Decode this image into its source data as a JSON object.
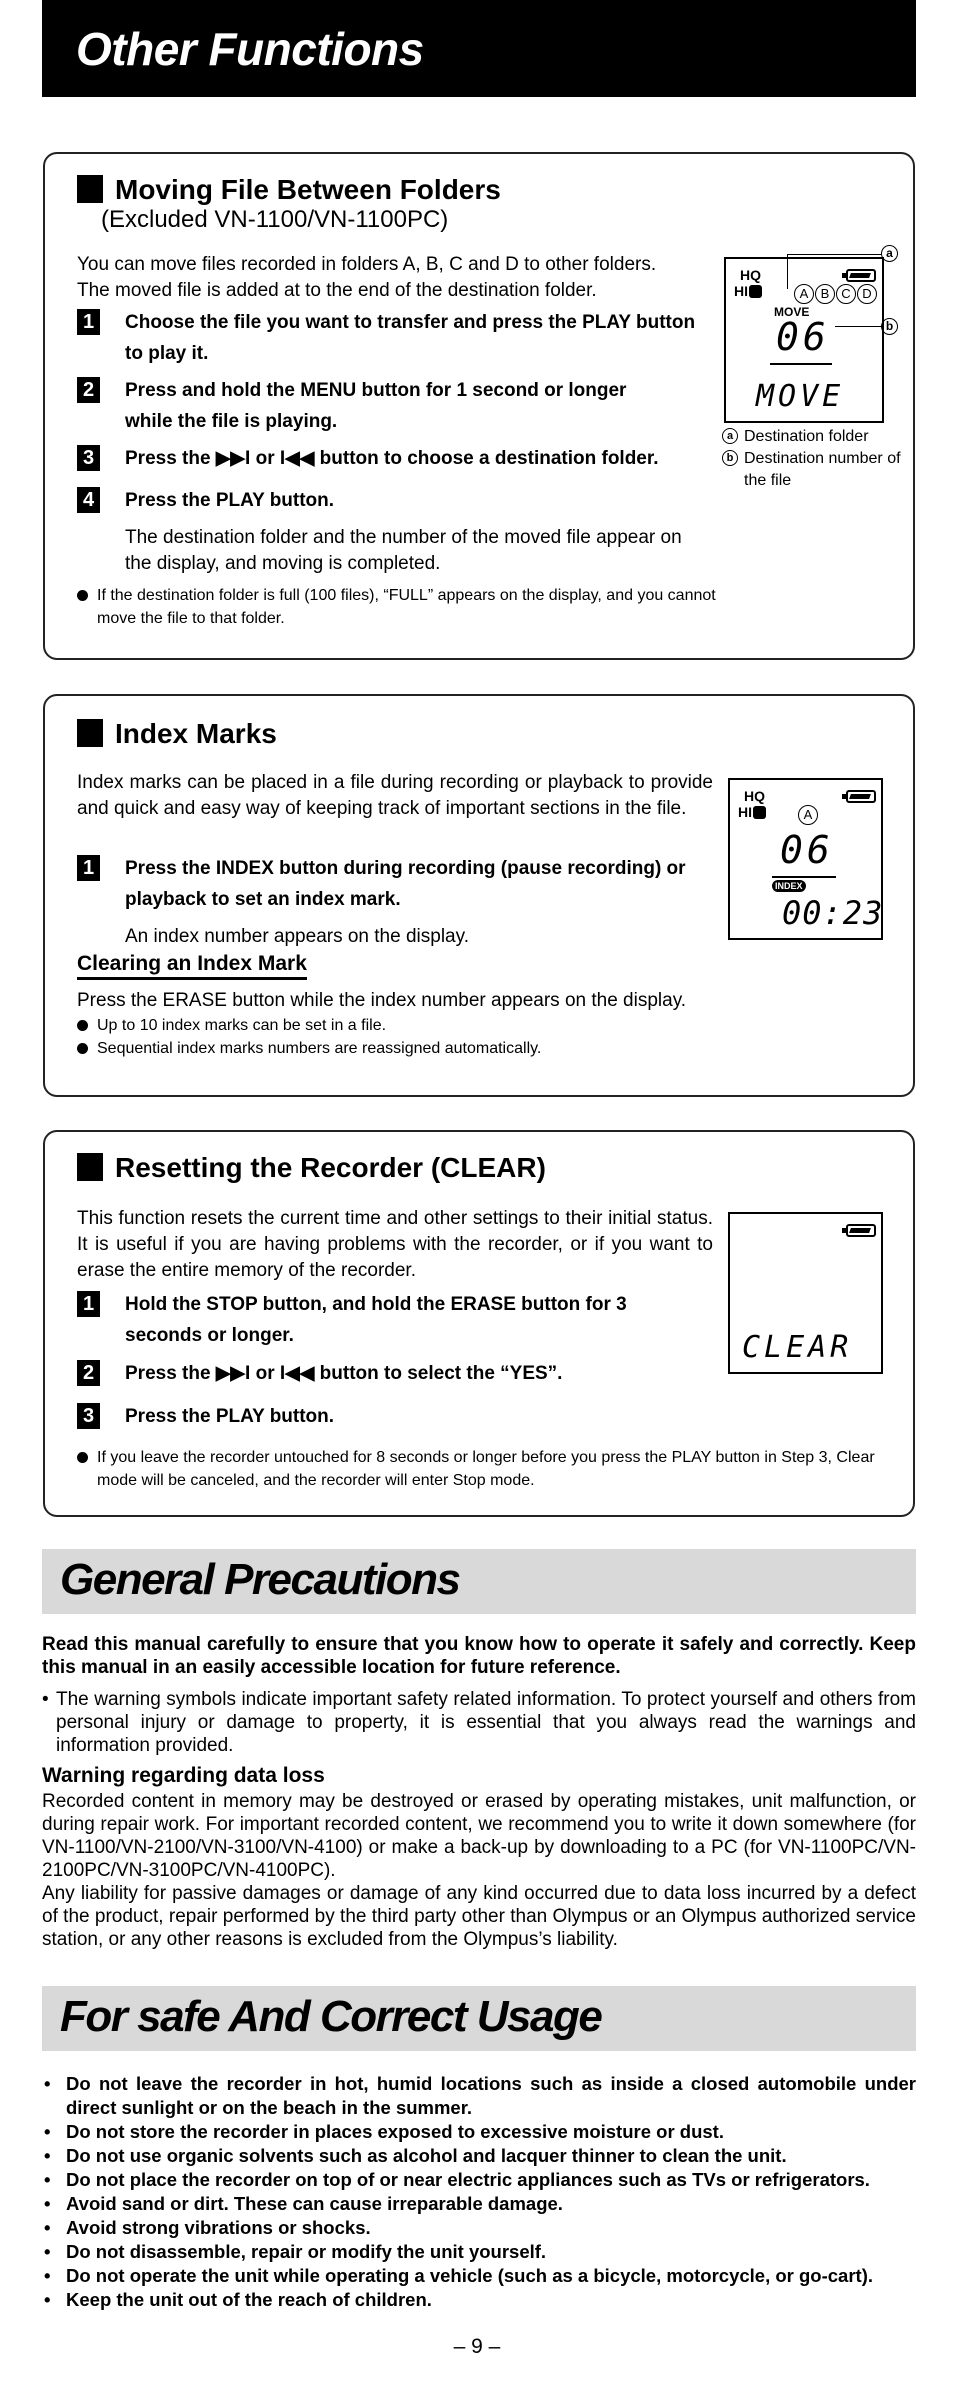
{
  "header": {
    "title": "Other Functions"
  },
  "moving_file": {
    "title": "Moving File Between Folders",
    "subtitle": "(Excluded VN-1100/VN-1100PC)",
    "intro_line1": "You can move files recorded in folders A, B, C and D to other folders.",
    "intro_line2": "The moved file is added at to the end of the destination folder.",
    "steps": [
      {
        "num": "1",
        "text": "Choose the file you want to transfer and press the PLAY button to play it."
      },
      {
        "num": "2",
        "text": "Press and hold the MENU button for 1 second or longer while the file is playing."
      },
      {
        "num": "3",
        "text": "Press the ▶▶I or I◀◀ button to choose a destination folder."
      },
      {
        "num": "4",
        "text": "Press the PLAY button."
      }
    ],
    "step4_detail": "The destination folder and the number of the moved file appear on the display, and moving is completed.",
    "note": "If the destination folder is full (100 files), “FULL” appears on the display, and you cannot move the file to that folder.",
    "lcd": {
      "hq": "HQ",
      "hi": "HI",
      "folders": [
        "A",
        "B",
        "C",
        "D"
      ],
      "move_label": "MOVE",
      "file_number": "06",
      "bottom_text": "MOVE",
      "callout_a": "a",
      "callout_b": "b"
    },
    "legend": [
      {
        "key": "a",
        "text": "Destination folder"
      },
      {
        "key": "b",
        "text": "Destination number of the file"
      }
    ]
  },
  "index_marks": {
    "title": "Index Marks",
    "intro": "Index marks can be placed in a file during recording or playback to provide and quick and easy way of keeping track of important sections in the file.",
    "steps": [
      {
        "num": "1",
        "text": "Press the INDEX button during recording (pause recording) or playback to set an index mark."
      }
    ],
    "step1_detail": "An index number appears on the display.",
    "clearing_title": "Clearing an Index Mark",
    "clearing_text": "Press the ERASE button while the index number appears on the display.",
    "notes": [
      "Up to 10 index marks can be set in a file.",
      "Sequential index marks numbers are reassigned automatically."
    ],
    "lcd": {
      "hq": "HQ",
      "hi": "HI",
      "folder": "A",
      "number": "06",
      "index_label": "INDEX",
      "time": "00:23"
    }
  },
  "resetting": {
    "title": "Resetting the Recorder (CLEAR)",
    "intro": "This function resets the current time and other settings to their initial status. It is useful if you are having problems with the recorder, or if you want to erase the entire memory of the recorder.",
    "steps": [
      {
        "num": "1",
        "text": "Hold the STOP button, and hold the ERASE button for 3 seconds or longer."
      },
      {
        "num": "2",
        "text": "Press the ▶▶I or I◀◀ button to select the “YES”."
      },
      {
        "num": "3",
        "text": "Press the PLAY button."
      }
    ],
    "note": "If you leave the recorder untouched for 8 seconds or longer before you press the PLAY button in Step 3, Clear mode will be canceled, and the recorder will enter Stop mode.",
    "lcd": {
      "bottom_text": "CLEAR"
    }
  },
  "general_precautions": {
    "title": "General Precautions",
    "lead": "Read this manual carefully to ensure that you know how to operate it safely and correctly. Keep this manual in an easily accessible location for future reference.",
    "bullet": "The warning symbols indicate important safety related information. To protect yourself and others from personal injury or damage to property, it is essential that you always read the warnings and information provided.",
    "warning_title": "Warning regarding data loss",
    "warning_p1": "Recorded content in memory may be destroyed or erased by operating mistakes, unit malfunction, or during repair work. For important recorded content, we recommend you to write it down somewhere (for VN-1100/VN-2100/VN-3100/VN-4100) or make a back-up by downloading to a PC (for VN-1100PC/VN-2100PC/VN-3100PC/VN-4100PC).",
    "warning_p2": "Any liability for passive damages or damage of any kind occurred due to data loss incurred by a defect of the product, repair performed by the third party other than Olympus or an Olympus authorized service station, or any other reasons is excluded from the Olympus’s liability."
  },
  "safe_usage": {
    "title": "For safe And Correct Usage",
    "items": [
      "Do not leave the recorder in hot, humid locations such as inside a closed automobile under direct sunlight or on the beach in the summer.",
      "Do not store the recorder in places exposed to excessive moisture or dust.",
      "Do not use organic solvents such as alcohol and lacquer thinner to clean the unit.",
      "Do not place the recorder on top of or near electric appliances such as TVs or refrigerators.",
      "Avoid sand or dirt. These can cause irreparable damage.",
      "Avoid strong vibrations or shocks.",
      "Do not disassemble, repair or modify the unit yourself.",
      "Do not operate the unit while operating a vehicle (such as a bicycle, motorcycle, or go-cart).",
      "Keep the unit out of the reach of children."
    ]
  },
  "footer": {
    "page_number": "– 9 –"
  }
}
